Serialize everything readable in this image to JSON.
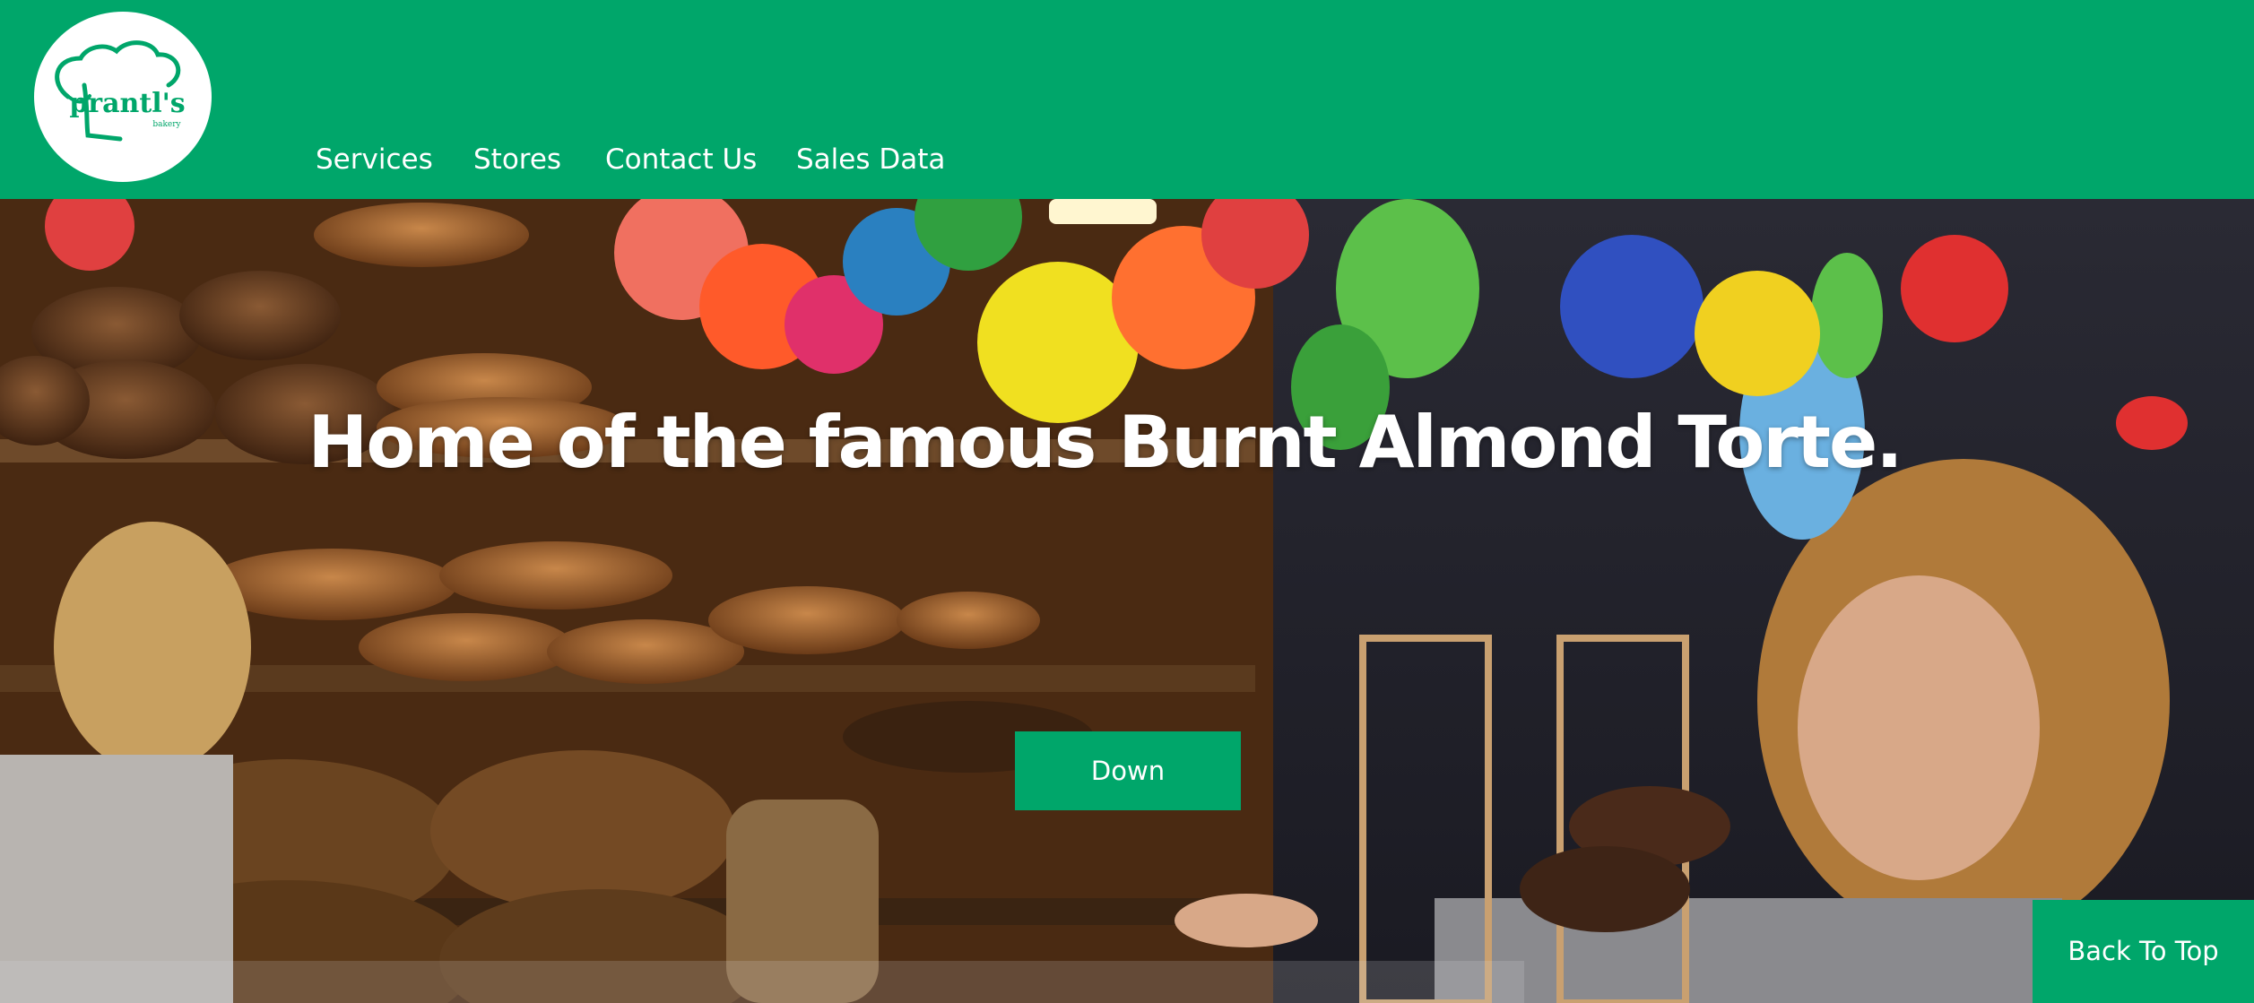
{
  "brand": {
    "logo_text": "prantl's",
    "logo_subtext": "bakery",
    "color": "#00a66a"
  },
  "nav": {
    "items": [
      {
        "label": "Services"
      },
      {
        "label": "Stores"
      },
      {
        "label": "Contact Us"
      },
      {
        "label": "Sales Data"
      }
    ]
  },
  "hero": {
    "headline": "Home of the famous Burnt Almond Torte.",
    "image_icon": "bakery-photo",
    "down_label": "Down"
  },
  "back_to_top": {
    "label": "Back To Top"
  }
}
